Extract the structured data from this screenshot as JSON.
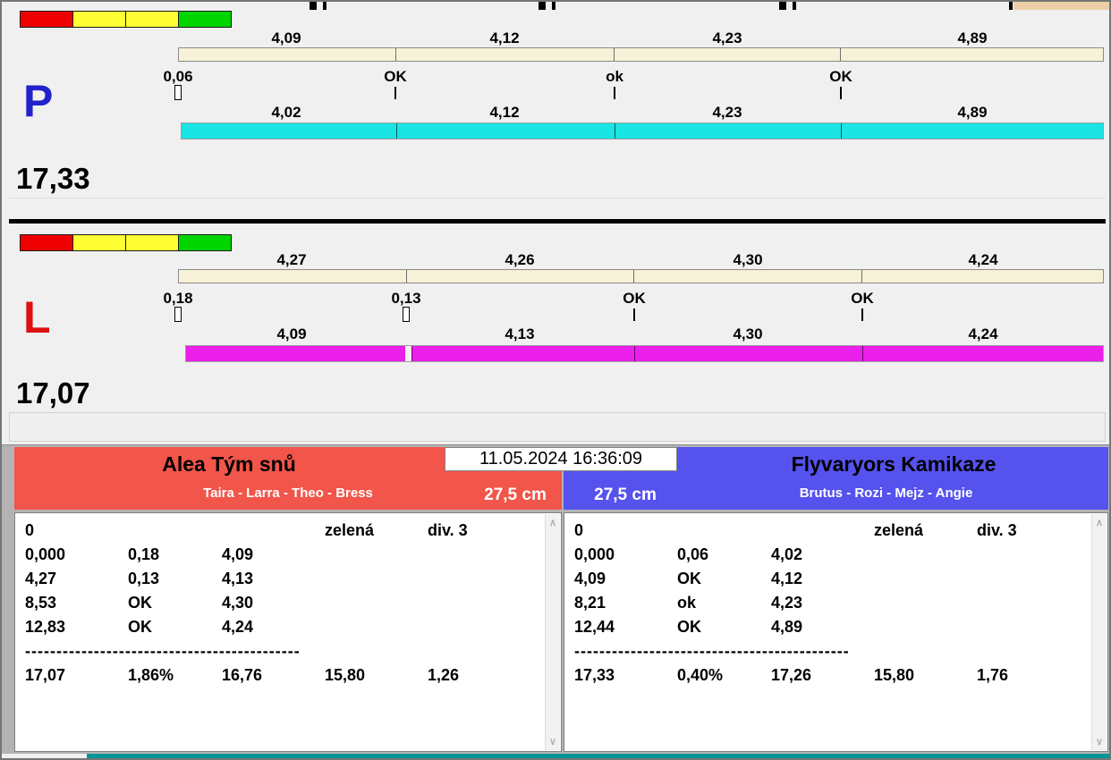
{
  "colors": {
    "window_bg": "#f0f0f0",
    "bottom_bg": "#b3b3b3",
    "teal_strip": "#019595",
    "track_cream": "#f6f2d8"
  },
  "icons": {
    "scroll_up": "∧",
    "scroll_down": "∨"
  },
  "traffic_light_colors": [
    "#ee0000",
    "#ffff33",
    "#ffff33",
    "#00d500"
  ],
  "lanes": [
    {
      "label": "P",
      "label_color": "#2222cc",
      "total": "17,33",
      "bar_color": "#1ae4e4",
      "upper_values": [
        "4,09",
        "4,12",
        "4,23",
        "4,89"
      ],
      "statuses": [
        {
          "label": "0,06",
          "marker": "box"
        },
        {
          "label": "OK",
          "marker": "line"
        },
        {
          "label": "ok",
          "marker": "line"
        },
        {
          "label": "OK",
          "marker": "line"
        }
      ],
      "lower_values": [
        "4,02",
        "4,12",
        "4,23",
        "4,89"
      ]
    },
    {
      "label": "L",
      "label_color": "#dd1111",
      "total": "17,07",
      "bar_color": "#ea1fea",
      "upper_values": [
        "4,27",
        "4,26",
        "4,30",
        "4,24"
      ],
      "statuses": [
        {
          "label": "0,18",
          "marker": "box"
        },
        {
          "label": "0,13",
          "marker": "box"
        },
        {
          "label": "OK",
          "marker": "line"
        },
        {
          "label": "OK",
          "marker": "line"
        }
      ],
      "lower_values": [
        "4,09",
        "4,13",
        "4,30",
        "4,24"
      ]
    }
  ],
  "datetime": "11.05.2024 16:36:09",
  "teams": [
    {
      "name": "Alea Tým snů",
      "members": "Taira - Larra - Theo - Bress",
      "hurdle_height": "27,5 cm",
      "header_color": "#f2554a",
      "rows": [
        {
          "cells": [
            "0",
            "",
            "",
            "zelená",
            "div. 3"
          ]
        },
        {
          "cells": [
            "0,000",
            "0,18",
            "4,09",
            "",
            ""
          ]
        },
        {
          "cells": [
            "4,27",
            "0,13",
            "4,13",
            "",
            ""
          ]
        },
        {
          "cells": [
            "8,53",
            "OK",
            "4,30",
            "",
            ""
          ]
        },
        {
          "cells": [
            "12,83",
            "OK",
            "4,24",
            "",
            ""
          ]
        },
        {
          "separator": "--------------------------------------------"
        },
        {
          "cells": [
            "17,07",
            "1,86%",
            "16,76",
            "15,80",
            "1,26"
          ]
        }
      ]
    },
    {
      "name": "Flyvaryors Kamikaze",
      "members": "Brutus - Rozi - Mejz - Angie",
      "hurdle_height": "27,5 cm",
      "header_color": "#5552ee",
      "rows": [
        {
          "cells": [
            "0",
            "",
            "",
            "zelená",
            "div. 3"
          ]
        },
        {
          "cells": [
            "0,000",
            "0,06",
            "4,02",
            "",
            ""
          ]
        },
        {
          "cells": [
            "4,09",
            "OK",
            "4,12",
            "",
            ""
          ]
        },
        {
          "cells": [
            "8,21",
            "ok",
            "4,23",
            "",
            ""
          ]
        },
        {
          "cells": [
            "12,44",
            "OK",
            "4,89",
            "",
            ""
          ]
        },
        {
          "separator": "--------------------------------------------"
        },
        {
          "cells": [
            "17,33",
            "0,40%",
            "17,26",
            "15,80",
            "1,76"
          ]
        }
      ]
    }
  ]
}
